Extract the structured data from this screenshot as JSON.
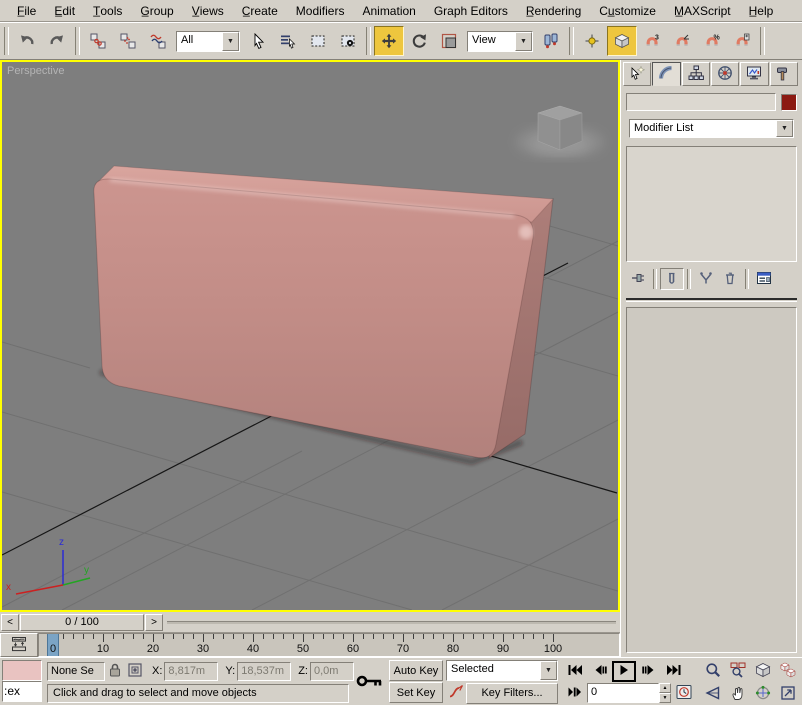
{
  "menubar": {
    "items": [
      "F̲ile",
      "E̲dit",
      "T̲ools",
      "G̲roup",
      "V̲iews",
      "C̲reate",
      "Modifiers",
      "Animation",
      "Graph Editors",
      "R̲endering",
      "Cu̲stomize",
      "M̲AXScript",
      "H̲elp"
    ]
  },
  "toolbar": {
    "buttons": [
      {
        "type": "sep"
      },
      {
        "type": "btn",
        "name": "undo"
      },
      {
        "type": "btn",
        "name": "redo"
      },
      {
        "type": "sep"
      },
      {
        "type": "btn",
        "name": "select-and-link"
      },
      {
        "type": "btn",
        "name": "unlink-selection"
      },
      {
        "type": "btn",
        "name": "bind-to-space-warp"
      },
      {
        "type": "dropdown",
        "name": "selection-filter",
        "value": "All",
        "width": 64
      },
      {
        "type": "btn",
        "name": "select-object"
      },
      {
        "type": "btn",
        "name": "select-by-name"
      },
      {
        "type": "btn",
        "name": "rectangular-selection-region"
      },
      {
        "type": "btn",
        "name": "window-crossing"
      },
      {
        "type": "sep"
      },
      {
        "type": "btn",
        "name": "select-and-move",
        "active": true
      },
      {
        "type": "btn",
        "name": "select-and-rotate"
      },
      {
        "type": "btn",
        "name": "select-and-scale"
      },
      {
        "type": "dropdown",
        "name": "reference-coordinate-system",
        "value": "View",
        "width": 66
      },
      {
        "type": "btn",
        "name": "use-pivot-point-center"
      },
      {
        "type": "sep"
      },
      {
        "type": "btn",
        "name": "select-and-manipulate"
      },
      {
        "type": "btn",
        "name": "snaps-toggle",
        "active": true
      },
      {
        "type": "btn",
        "name": "snaps-toggle-3d"
      },
      {
        "type": "btn",
        "name": "angle-snap-toggle"
      },
      {
        "type": "btn",
        "name": "percent-snap-toggle"
      },
      {
        "type": "btn",
        "name": "spinner-snap-toggle"
      },
      {
        "type": "sep"
      }
    ],
    "active_color": "#eec63e"
  },
  "viewport": {
    "label": "Perspective",
    "background": "#7e7e7e",
    "border_color": "#ffff00",
    "axis_labels": {
      "x": "x",
      "y": "y",
      "z": "z"
    },
    "object_colors": {
      "front": "#c18c86",
      "top": "#d5a19a",
      "side": "#a3756f"
    }
  },
  "command_panel": {
    "tabs": [
      {
        "name": "create"
      },
      {
        "name": "modify",
        "active": true
      },
      {
        "name": "hierarchy"
      },
      {
        "name": "motion"
      },
      {
        "name": "display"
      },
      {
        "name": "utilities"
      }
    ],
    "object_name_value": "",
    "color_swatch": "#8c1a12",
    "modifier_list_label": "Modifier List",
    "stack_buttons": [
      "pin-stack",
      "show-end-result",
      "make-unique",
      "remove-modifier",
      "configure-modifier-sets"
    ]
  },
  "time_slider": {
    "value": "0 / 100",
    "prev": "<",
    "next": ">"
  },
  "track_bar": {
    "start": 0,
    "end": 100,
    "label_step": 10,
    "tick_step": 2,
    "current_frame": 0,
    "marker_color": "#7ba4c5"
  },
  "status_bar": {
    "listener_text": ":ex",
    "listener_pink": "#e9c3c1",
    "selection_status": "None Se",
    "coords": {
      "x_label": "X:",
      "x": "8,817m",
      "y_label": "Y:",
      "y": "18,537m",
      "z_label": "Z:",
      "z": "0,0m"
    },
    "prompt": "Click and drag to select and move objects",
    "auto_key": "Auto Key",
    "set_key": "Set Key",
    "key_mode_dropdown": "Selected",
    "key_filters": "Key Filters...",
    "frame_field": "0",
    "transport": [
      "go-to-start",
      "previous-frame",
      "play",
      "next-frame",
      "go-to-end"
    ],
    "transport_row2": [
      "key-mode-toggle"
    ],
    "time_config": "time-configuration",
    "nav": [
      "zoom",
      "zoom-all",
      "zoom-extents",
      "zoom-extents-all",
      "field-of-view",
      "pan",
      "arc-rotate",
      "min-max-toggle"
    ]
  }
}
